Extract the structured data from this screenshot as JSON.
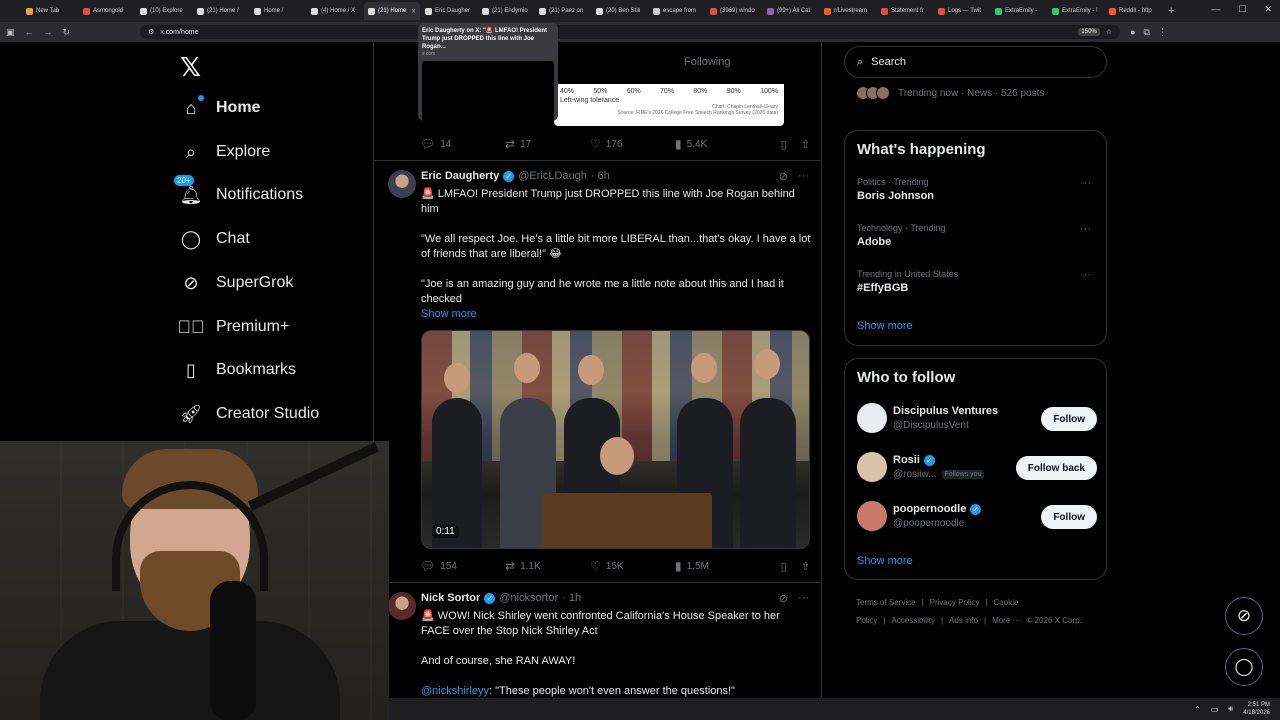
{
  "browser": {
    "tabs": [
      {
        "label": "New Tab",
        "color": "#e6a23c"
      },
      {
        "label": "Asmongold",
        "color": "#e74c3c"
      },
      {
        "label": "(10) Explore",
        "color": "#dddddd"
      },
      {
        "label": "(21) Home /",
        "color": "#dddddd"
      },
      {
        "label": "Home /",
        "color": "#dddddd"
      },
      {
        "label": "(4) Home / X",
        "color": "#dddddd"
      },
      {
        "label": "(21) Home",
        "color": "#dddddd"
      },
      {
        "label": "Eric Daugher",
        "color": "#dddddd"
      },
      {
        "label": "(21) Endymio",
        "color": "#dddddd"
      },
      {
        "label": "(21) Paez on",
        "color": "#dddddd"
      },
      {
        "label": "(20) Ben Stili",
        "color": "#dddddd"
      },
      {
        "label": "escape from",
        "color": "#cccccc"
      },
      {
        "label": "(3969) windo",
        "color": "#e74c3c"
      },
      {
        "label": "(99+) All Cat",
        "color": "#9b59b6"
      },
      {
        "label": "r/Livestream",
        "color": "#ff5722"
      },
      {
        "label": "Statement fr",
        "color": "#e74c3c"
      },
      {
        "label": "Logs — Twit",
        "color": "#e74c3c"
      },
      {
        "label": "ExtraEmily -",
        "color": "#2ecc71"
      },
      {
        "label": "ExtraEmily - !",
        "color": "#2ecc71"
      },
      {
        "label": "Reddit - http",
        "color": "#ff5722"
      }
    ],
    "active_tab_index": 6,
    "url": "x.com/home",
    "zoom": "150%",
    "tooltip": {
      "title": "Eric Daugherty on X: \"🚨 LMFAO! President Trump just DROPPED this line with Joe Rogan...",
      "domain": "x.com"
    }
  },
  "nav": {
    "items": [
      {
        "label": "Home",
        "icon": "home-icon",
        "bold": true
      },
      {
        "label": "Explore",
        "icon": "search-icon"
      },
      {
        "label": "Notifications",
        "icon": "bell-icon",
        "badge": "20+"
      },
      {
        "label": "Chat",
        "icon": "chat-icon"
      },
      {
        "label": "SuperGrok",
        "icon": "grok-icon"
      },
      {
        "label": "Premium+",
        "icon": "premium-icon"
      },
      {
        "label": "Bookmarks",
        "icon": "bookmark-icon"
      },
      {
        "label": "Creator Studio",
        "icon": "rocket-icon"
      }
    ]
  },
  "timeline": {
    "following_tab": "Following",
    "chart_snippet": {
      "ticks": [
        "40%",
        "50%",
        "60%",
        "70%",
        "80%",
        "90%",
        "100%"
      ],
      "label": "Left-wing tolerance",
      "credit": "Chart: Chapin Lenthall-Cleary",
      "source": "Source: FIRE's 2026 College Free Speech Rankings Survey (2025 data)"
    },
    "prev_actions": {
      "replies": "14",
      "reposts": "17",
      "likes": "176",
      "views": "5.4K"
    },
    "tweets": [
      {
        "name": "Eric Daugherty",
        "handle": "@EricLDaugh",
        "time": "· 6h",
        "text1": "🚨 LMFAO! President Trump just DROPPED this line with Joe Rogan behind him",
        "text2": "\"We all respect Joe. He's a little bit more LIBERAL than...that's okay. I have a lot of friends that are liberal!\" 😂",
        "text3": "\"Joe is an amazing guy and he wrote me a little note about this and I had it checked",
        "show_more": "Show more",
        "duration": "0:11",
        "actions": {
          "replies": "154",
          "reposts": "1.1K",
          "likes": "15K",
          "views": "1.5M"
        }
      },
      {
        "name": "Nick Sortor",
        "handle": "@nicksortor",
        "time": "· 1h",
        "text1": "🚨 WOW! Nick Shirley went confronted California's House Speaker to her FACE over the Stop Nick Shirley Act",
        "text2": "And of course, she RAN AWAY!",
        "mention": "@nickshirleyy",
        "text3": ": \"These people won't even answer the questions!\""
      }
    ]
  },
  "sidebar": {
    "search_placeholder": "Search",
    "trending_now": "Trending now · News · 526 posts",
    "happening_title": "What's happening",
    "trends": [
      {
        "context": "Politics · Trending",
        "title": "Boris Johnson"
      },
      {
        "context": "Technology · Trending",
        "title": "Adobe"
      },
      {
        "context": "Trending in United States",
        "title": "#EffyBGB"
      }
    ],
    "show_more": "Show more",
    "who_title": "Who to follow",
    "who": [
      {
        "name": "Discipulus Ventures",
        "handle": "@DiscipulusVent",
        "button": "Follow",
        "verified": false,
        "follows_you": ""
      },
      {
        "name": "Rosii",
        "handle": "@rosiiw...",
        "button": "Follow back",
        "verified": true,
        "follows_you": "Follows you"
      },
      {
        "name": "poopernoodle",
        "handle": "@poopernoodle",
        "button": "Follow",
        "verified": true,
        "follows_you": ""
      }
    ],
    "footer": [
      "Terms of Service",
      "|",
      "Privacy Policy",
      "|",
      "Cookie Policy",
      "|",
      "Accessibility",
      "|",
      "Ads info",
      "|",
      "More ···",
      "© 2026 X Corp."
    ]
  },
  "taskbar": {
    "time": "2:51 PM",
    "date": "4/18/2026"
  },
  "colors": {
    "accent": "#1d9bf0",
    "background": "#000000",
    "border": "#2f3336",
    "muted": "#71767b"
  }
}
